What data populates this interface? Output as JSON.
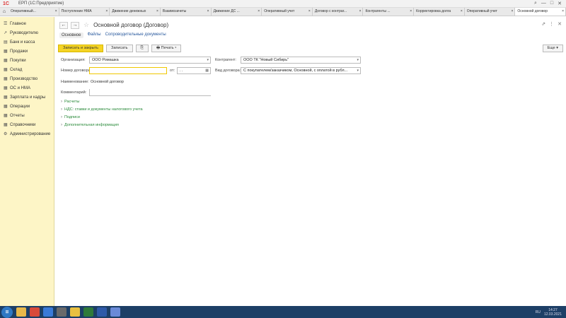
{
  "app": {
    "logo": "1С",
    "title": "ЕРП (1С:Предприятие)",
    "controls": [
      "⌕",
      "—",
      "□",
      "✕"
    ]
  },
  "tabs": [
    {
      "label": "Оперативный...",
      "active": false
    },
    {
      "label": "Поступление НМА",
      "active": false
    },
    {
      "label": "Движение денежных",
      "active": false
    },
    {
      "label": "Взаимозачеты",
      "active": false
    },
    {
      "label": "Движение ДС ...",
      "active": false
    },
    {
      "label": "Оперативный учет",
      "active": false
    },
    {
      "label": "Договор с контраг...",
      "active": false
    },
    {
      "label": "Контрагенты ...",
      "active": false
    },
    {
      "label": "Корректировка долга",
      "active": false
    },
    {
      "label": "Оперативный учет",
      "active": false
    },
    {
      "label": "Основной договор",
      "active": true
    }
  ],
  "sidebar": {
    "items": [
      {
        "icon": "☰",
        "label": "Главное"
      },
      {
        "icon": "↗",
        "label": "Руководителю"
      },
      {
        "icon": "▤",
        "label": "Банк и касса"
      },
      {
        "icon": "▦",
        "label": "Продажи"
      },
      {
        "icon": "▦",
        "label": "Покупки"
      },
      {
        "icon": "▦",
        "label": "Склад"
      },
      {
        "icon": "▦",
        "label": "Производство"
      },
      {
        "icon": "▦",
        "label": "ОС и НМА"
      },
      {
        "icon": "▦",
        "label": "Зарплата и кадры"
      },
      {
        "icon": "▦",
        "label": "Операции"
      },
      {
        "icon": "▦",
        "label": "Отчеты"
      },
      {
        "icon": "▦",
        "label": "Справочники"
      },
      {
        "icon": "⚙",
        "label": "Администрирование"
      }
    ]
  },
  "header": {
    "title": "Основной договор (Договор)",
    "back": "←",
    "forward": "→",
    "star": "☆",
    "right_icons": [
      "⇗",
      "⋮",
      "✕"
    ]
  },
  "sections": [
    {
      "label": "Основное",
      "active": true
    },
    {
      "label": "Файлы",
      "active": false
    },
    {
      "label": "Сопроводительные документы",
      "active": false
    }
  ],
  "toolbar": {
    "save_close": "Записать и закрыть",
    "save": "Записать",
    "attach": "⎘",
    "print": "🖶 Печать ▾",
    "more": "Еще ▾"
  },
  "form": {
    "org_label": "Организация:",
    "org_value": "ООО Ромашка",
    "counterparty_label": "Контрагент:",
    "counterparty_value": "ООО ТК \"Новый Сибирь\"",
    "number_label": "Номер договора:",
    "number_value": "",
    "date_label": "от:",
    "date_value": ". .",
    "type_label": "Вид договора:",
    "type_value": "С покупателем/заказчиком, Основной, с оплатой в рубл...",
    "name_label": "Наименование:",
    "name_value": "Основной договор",
    "comment_label": "Комментарий:",
    "comment_value": ""
  },
  "groups": [
    "Расчеты",
    "НДС: ставки и документы налогового учета",
    "Подписи",
    "Дополнительная информация"
  ],
  "taskbar": {
    "start": "⊞",
    "time": "14:27",
    "date": "12.03.2021",
    "lang": "RU"
  }
}
